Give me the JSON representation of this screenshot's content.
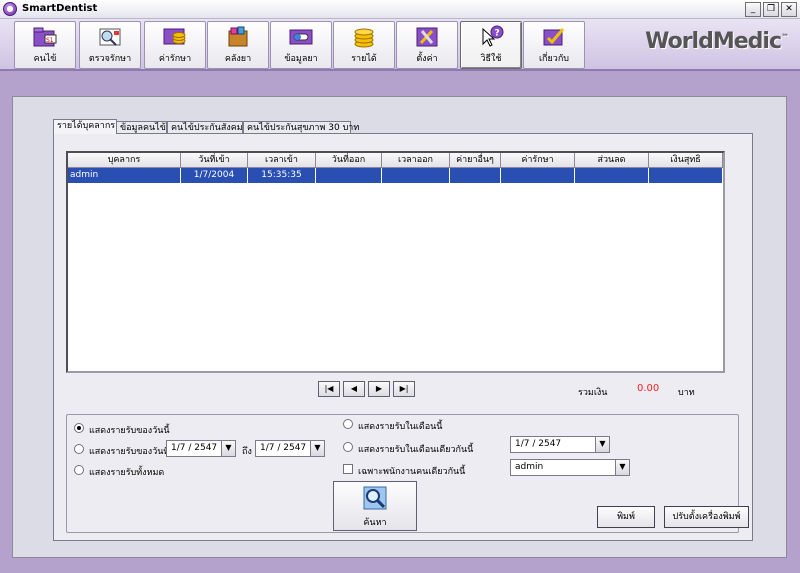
{
  "window": {
    "title": "SmartDentist",
    "app_icon": "app-logo-icon",
    "minimize": "_",
    "maximize": "❐",
    "close": "✕"
  },
  "toolbar": {
    "items": [
      {
        "label": "คนไข้",
        "icon": "patient-folder-icon"
      },
      {
        "label": "ตรวจรักษา",
        "icon": "examination-icon"
      },
      {
        "label": "ค่ารักษา",
        "icon": "treatment-fee-icon"
      },
      {
        "label": "คลังยา",
        "icon": "pharmacy-icon"
      },
      {
        "label": "ข้อมูลยา",
        "icon": "drug-info-icon"
      },
      {
        "label": "รายได้",
        "icon": "income-icon"
      },
      {
        "label": "ตั้งค่า",
        "icon": "settings-tools-icon"
      },
      {
        "label": "วิธีใช้",
        "icon": "help-icon"
      },
      {
        "label": "เกี่ยวกับ",
        "icon": "about-icon"
      }
    ],
    "active_index": 7,
    "brand": "WorldMedic",
    "brand_tm": "™"
  },
  "tabs": [
    {
      "label": "รายได้บุคลากร"
    },
    {
      "label": "ข้อมูลคนไข้"
    },
    {
      "label": "คนไข้ประกันสังคม"
    },
    {
      "label": "คนไข้ประกันสุขภาพ 30 บาท"
    }
  ],
  "grid": {
    "columns": [
      "บุคลากร",
      "วันที่เข้า",
      "เวลาเข้า",
      "วันที่ออก",
      "เวลาออก",
      "ค่ายาอื่นๆ",
      "ค่ารักษา",
      "ส่วนลด",
      "เงินสุทธิ"
    ],
    "rows": [
      [
        "admin",
        "1/7/2004",
        "15:35:35",
        "",
        "",
        "",
        "",
        "",
        ""
      ]
    ]
  },
  "navigation": {
    "first": "|◀",
    "prev": "◀",
    "next": "▶",
    "last": "▶|"
  },
  "summary": {
    "total_label": "รวมเงิน",
    "total_value": "0.00",
    "unit": "บาท",
    "value_color": "#e22222"
  },
  "options": {
    "today": "แสดงรายรับของวันนี้",
    "by_date": "แสดงรายรับของวันที่",
    "to_label": "ถึง",
    "date_from": "1/7 / 2547",
    "date_to": "1/7 / 2547",
    "all": "แสดงรายรับทั้งหมด",
    "this_month": "แสดงรายรับในเดือนนี้",
    "same_month": "แสดงรายรับในเดือนเดียวกันนี้",
    "month_value": "1/7 / 2547",
    "same_staff": "เฉพาะพนักงานคนเดียวกันนี้",
    "staff_value": "admin",
    "selected": "today"
  },
  "buttons": {
    "search": "ค้นหา",
    "print": "พิมพ์",
    "printer_setup": "ปรับตั้งเครื่องพิมพ์"
  }
}
